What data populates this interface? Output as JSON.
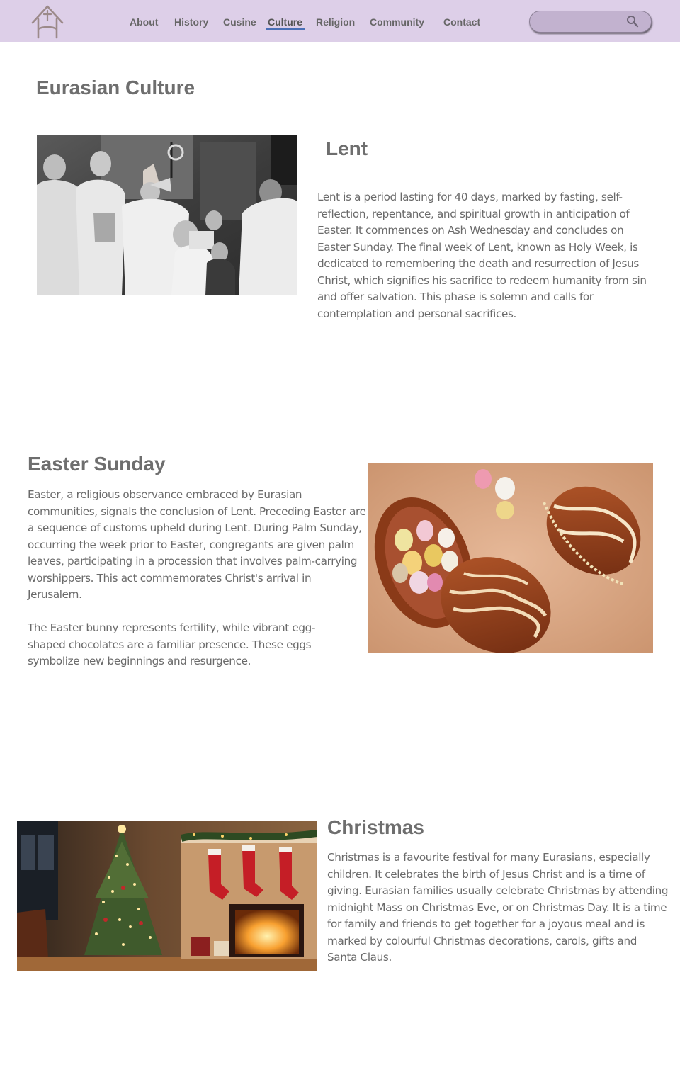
{
  "nav": {
    "items": [
      {
        "label": "About"
      },
      {
        "label": "History"
      },
      {
        "label": "Cusine"
      },
      {
        "label": "Culture"
      },
      {
        "label": "Religion"
      },
      {
        "label": "Community"
      },
      {
        "label": "Contact"
      }
    ],
    "active": "Culture",
    "logo_icon": "house-cross-logo-icon",
    "search_icon": "search-icon",
    "search_placeholder": ""
  },
  "page": {
    "title": "Eurasian Culture"
  },
  "sections": {
    "lent": {
      "title": "Lent",
      "body": "Lent is a period lasting for 40 days, marked by fasting, self-reflection, repentance, and spiritual growth in anticipation of Easter. It commences on Ash Wednesday and concludes on Easter Sunday. The final week of Lent, known as Holy Week, is dedicated to remembering the death and resurrection of Jesus Christ, which signifies his sacrifice to redeem humanity from sin and offer salvation. This phase is solemn and calls for contemplation and personal sacrifices."
    },
    "easter": {
      "title": "Easter Sunday",
      "body1": "Easter, a religious observance embraced by Eurasian communities, signals the conclusion of Lent. Preceding Easter are a sequence of customs upheld during Lent. During Palm Sunday, occurring the week prior to Easter, congregants are given palm leaves, participating in a procession that involves palm-carrying worshippers. This act commemorates Christ's arrival in Jerusalem.",
      "body2": "The Easter bunny represents fertility, while vibrant egg-shaped chocolates are a familiar presence. These eggs symbolize new beginnings and resurgence."
    },
    "christmas": {
      "title": "Christmas",
      "body": "Christmas is a favourite festival for many Eurasians, especially children. It celebrates the birth of Jesus Christ and is a time of giving. Eurasian families usually celebrate Christmas by attending midnight Mass on Christmas Eve, or on Christmas Day. It is a time for family and friends to get together for a joyous meal and is marked by colourful Christmas decorations, carols, gifts and Santa Claus."
    }
  },
  "colors": {
    "nav_bg": "#ddcfe8",
    "search_bg": "#c2b2cf",
    "active_underline": "#4a6fb6",
    "text": "#6a6a6a"
  }
}
